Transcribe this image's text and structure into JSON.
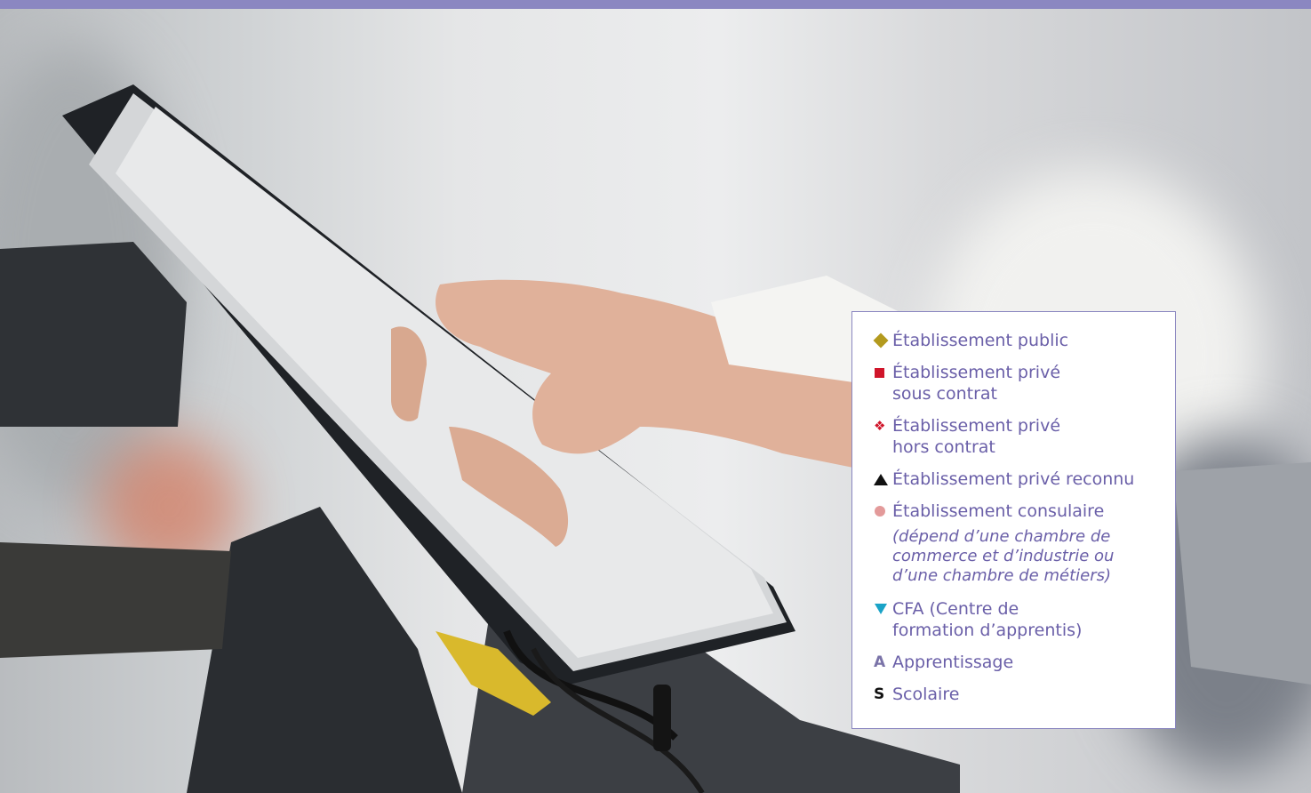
{
  "colors": {
    "band": "#8b87c1",
    "text": "#6a5fa8",
    "diamond": "#b39a1e",
    "square": "#d0152a",
    "fleuron": "#d0152a",
    "triangle": "#111111",
    "dot": "#e39a9a",
    "tri_down": "#1aa3c7",
    "letter_a": "#7a73a8",
    "letter_s": "#111111"
  },
  "legend": {
    "items": [
      {
        "icon": "diamond-icon",
        "label": "Établissement public"
      },
      {
        "icon": "square-icon",
        "label": "Établissement privé sous contrat"
      },
      {
        "icon": "fleuron-icon",
        "symbol": "❖",
        "label": "Établissement privé hors contrat"
      },
      {
        "icon": "triangle-up-icon",
        "label": "Établissement privé reconnu"
      },
      {
        "icon": "dot-icon",
        "label": "Établissement consulaire"
      },
      {
        "icon": "triangle-down-icon",
        "label": "CFA (Centre de formation d’apprentis)"
      },
      {
        "icon": "letter-a-icon",
        "symbol": "A",
        "label": "Apprentissage"
      },
      {
        "icon": "letter-s-icon",
        "symbol": "S",
        "label": "Scolaire"
      }
    ],
    "consulaire_note": "(dépend d’une chambre de commerce et d’industrie ou d’une chambre de métiers)"
  }
}
